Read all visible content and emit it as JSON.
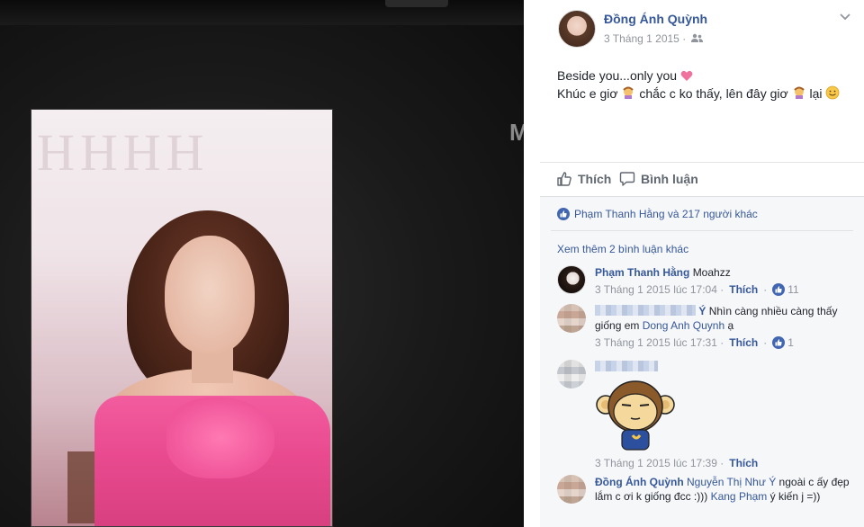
{
  "photo": {
    "side_text": "M",
    "backdrop_text": "HHHH"
  },
  "post": {
    "author": "Đồng Ánh Quỳnh",
    "time": "3 Tháng 1 2015 ·",
    "text_line1": "Beside you...only you",
    "text_line2_a": "Khúc e giơ",
    "text_line2_b": "chắc c ko thấy, lên đây giơ",
    "text_line2_c": "lại"
  },
  "actions": {
    "like_label": "Thích",
    "comment_label": "Bình luận"
  },
  "reactions": {
    "summary": "Phạm Thanh Hằng và 217 người khác"
  },
  "comments_section": {
    "more_label": "Xem thêm 2 bình luận khác"
  },
  "comments": [
    {
      "name": "Phạm Thanh Hằng",
      "text": "Moahzz",
      "time": "3 Tháng 1 2015 lúc 17:04 ·",
      "like": "Thích",
      "likes": "11"
    },
    {
      "name_tail": "Ý",
      "text_a": "Nhìn càng nhiều càng thấy giống em",
      "mention": "Dong Anh Quynh",
      "text_b": "ạ",
      "time": "3 Tháng 1 2015 lúc 17:31 ·",
      "like": "Thích",
      "likes": "1"
    },
    {
      "time": "3 Tháng 1 2015 lúc 17:39 ·",
      "like": "Thích"
    },
    {
      "name": "Đồng Ánh Quỳnh",
      "mention": "Nguyễn Thị Như Ý",
      "text_a": "ngoài c ấy đẹp lắm c ơi k giống đcc :)))",
      "mention2": "Kang Phạm",
      "text_b": "ý kiến j =))"
    }
  ],
  "colors": {
    "link": "#365899",
    "muted": "#90949c",
    "like_blue": "#4267b2",
    "dress_pink": "#f25c9e"
  }
}
